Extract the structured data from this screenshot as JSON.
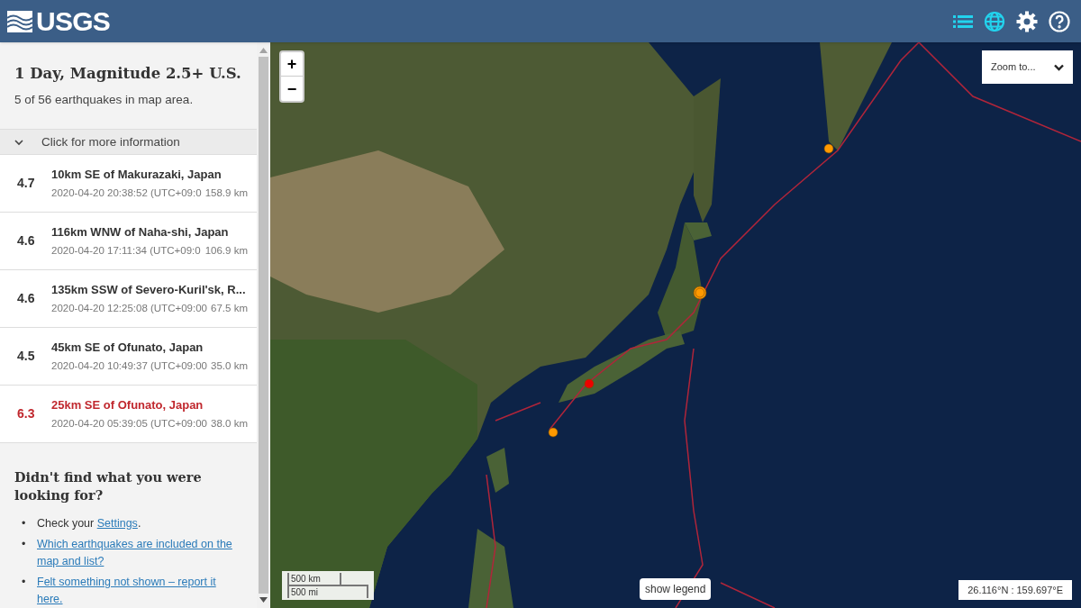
{
  "header": {
    "logo": "USGS"
  },
  "sidebar": {
    "title": "1 Day, Magnitude 2.5+ U.S.",
    "subtitle": "5 of 56 earthquakes in map area.",
    "more_info": {
      "label": "Click for more information",
      "expanded": false
    },
    "earthquakes": [
      {
        "magnitude": "4.7",
        "place": "10km SE of Makurazaki, Japan",
        "time": "2020-04-20 20:38:52 (UTC+09:0",
        "depth": "158.9 km",
        "significant": false
      },
      {
        "magnitude": "4.6",
        "place": "116km WNW of Naha-shi, Japan",
        "time": "2020-04-20 17:11:34 (UTC+09:0",
        "depth": "106.9 km",
        "significant": false
      },
      {
        "magnitude": "4.6",
        "place": "135km SSW of Severo-Kuril'sk, R...",
        "time": "2020-04-20 12:25:08 (UTC+09:00",
        "depth": "67.5 km",
        "significant": false
      },
      {
        "magnitude": "4.5",
        "place": "45km SE of Ofunato, Japan",
        "time": "2020-04-20 10:49:37 (UTC+09:00",
        "depth": "35.0 km",
        "significant": false
      },
      {
        "magnitude": "6.3",
        "place": "25km SE of Ofunato, Japan",
        "time": "2020-04-20 05:39:05 (UTC+09:00",
        "depth": "38.0 km",
        "significant": true
      }
    ],
    "help": {
      "heading": "Didn't find what you were looking for?",
      "items": [
        {
          "kind": "text",
          "bullet": "•",
          "before": "Check your ",
          "link": "Settings",
          "after": "."
        },
        {
          "kind": "link",
          "bullet": "•",
          "link": "Which earthquakes are included on the map and list?"
        },
        {
          "kind": "link",
          "bullet": "•",
          "link": "Felt something not shown – report it here."
        }
      ]
    }
  },
  "map": {
    "zoom_in": "+",
    "zoom_out": "−",
    "zoom_to": "Zoom to...",
    "scale_km": "500 km",
    "scale_mi": "500 mi",
    "legend_button": "show legend",
    "coordinates": "26.116°N : 159.697°E",
    "markers": [
      {
        "color": "#ff9900"
      },
      {
        "color": "#ff9900"
      },
      {
        "color": "#ff9900"
      },
      {
        "color": "#ff9900"
      },
      {
        "color": "#ee0000"
      }
    ]
  }
}
